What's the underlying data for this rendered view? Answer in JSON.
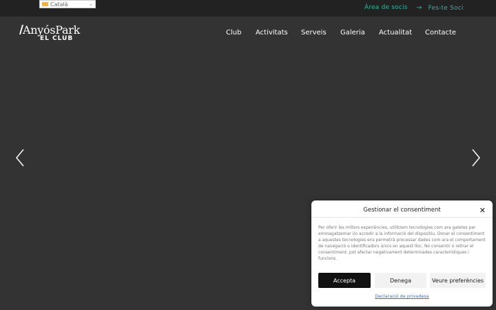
{
  "colors": {
    "background": "#333333",
    "topbar": "#222222",
    "accent": "#3bb0a0",
    "accept_button": "#111111"
  },
  "language": {
    "selected": "Català"
  },
  "topbar": {
    "members_area": "Àrea de socis",
    "become_member": "Fes-te Soci"
  },
  "logo": {
    "name": "AnyósPark",
    "subtitle": "EL CLUB"
  },
  "nav": {
    "items": [
      {
        "label": "Club"
      },
      {
        "label": "Activitats"
      },
      {
        "label": "Serveis"
      },
      {
        "label": "Galeria"
      },
      {
        "label": "Actualitat"
      },
      {
        "label": "Contacte"
      }
    ]
  },
  "slider": {
    "prev_icon": "chevron-left-icon",
    "next_icon": "chevron-right-icon"
  },
  "consent": {
    "title": "Gestionar el consentiment",
    "close_icon": "close-icon",
    "body": "Per oferir les millors experiències, utilitzem tecnologies com ara galetes per emmagatzemar i/o accedir a la informació del dispositiu. Donar el consentiment a aquestes tecnologies ens permetrà processar dades com ara el comportament de navegació o identificadors únics en aquest lloc. No consentir o retirar el consentiment, pot afectar negativament determinades característiques i funcions.",
    "accept": "Accepta",
    "deny": "Denega",
    "preferences": "Veure preferències",
    "policy_link": "Declaració de privadesa"
  }
}
